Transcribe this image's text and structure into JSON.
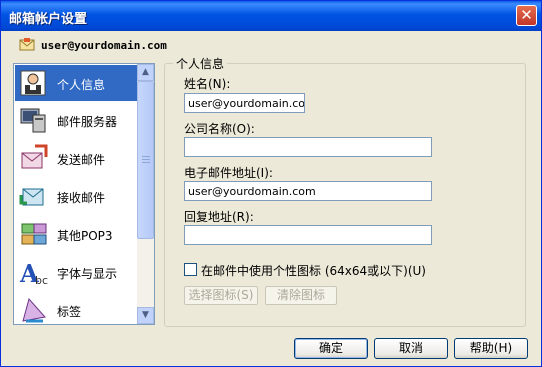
{
  "window": {
    "title": "邮箱帐户设置",
    "close_label": "✕"
  },
  "account": {
    "email": "user@yourdomain.com"
  },
  "sidebar": {
    "items": [
      {
        "label": "个人信息",
        "icon": "person-card-icon",
        "selected": true
      },
      {
        "label": "邮件服务器",
        "icon": "server-icon"
      },
      {
        "label": "发送邮件",
        "icon": "send-mail-icon"
      },
      {
        "label": "接收邮件",
        "icon": "receive-mail-icon"
      },
      {
        "label": "其他POP3",
        "icon": "pop3-icon"
      },
      {
        "label": "字体与显示",
        "icon": "font-icon"
      },
      {
        "label": "标签",
        "icon": "tag-icon"
      }
    ]
  },
  "personal": {
    "group_title": "个人信息",
    "name_label": "姓名(N):",
    "name_value": "user@yourdomain.com",
    "company_label": "公司名称(O):",
    "company_value": "",
    "email_label": "电子邮件地址(I):",
    "email_value": "user@yourdomain.com",
    "reply_label": "回复地址(R):",
    "reply_value": "",
    "custom_icon_label": "在邮件中使用个性图标 (64x64或以下)(U)",
    "custom_icon_checked": false,
    "choose_icon_label": "选择图标(S)",
    "clear_icon_label": "清除图标"
  },
  "footer": {
    "ok_label": "确定",
    "cancel_label": "取消",
    "help_label": "帮助(H)"
  }
}
